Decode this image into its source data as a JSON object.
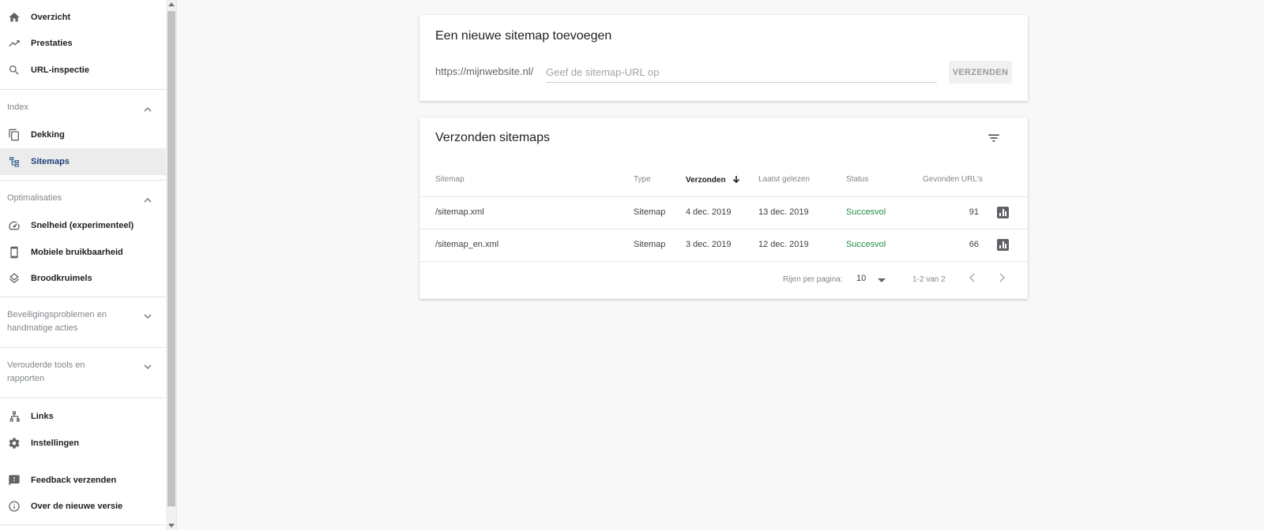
{
  "sidebar": {
    "top_items": [
      {
        "label": "Overzicht",
        "icon": "home-icon"
      },
      {
        "label": "Prestaties",
        "icon": "trending-up-icon"
      },
      {
        "label": "URL-inspectie",
        "icon": "search-icon"
      }
    ],
    "sections": {
      "index": {
        "label": "Index",
        "expanded": true
      },
      "optimalisaties": {
        "label": "Optimalisaties",
        "expanded": true
      },
      "beveiliging": {
        "line1": "Beveiligingsproblemen en",
        "line2": "handmatige acties",
        "expanded": false
      },
      "verouderd": {
        "line1": "Verouderde tools en",
        "line2": "rapporten",
        "expanded": false
      }
    },
    "index_items": [
      {
        "label": "Dekking",
        "icon": "copy-pages-icon"
      },
      {
        "label": "Sitemaps",
        "icon": "sitemap-icon",
        "active": true
      }
    ],
    "optim_items": [
      {
        "label": "Snelheid (experimenteel)",
        "icon": "speedometer-icon"
      },
      {
        "label": "Mobiele bruikbaarheid",
        "icon": "smartphone-icon"
      },
      {
        "label": "Broodkruimels",
        "icon": "layers-icon"
      }
    ],
    "bottom_items": [
      {
        "label": "Links",
        "icon": "network-icon"
      },
      {
        "label": "Instellingen",
        "icon": "gear-icon"
      },
      {
        "label": "Feedback verzenden",
        "icon": "feedback-icon"
      },
      {
        "label": "Over de nieuwe versie",
        "icon": "info-icon"
      }
    ]
  },
  "add_card": {
    "title": "Een nieuwe sitemap toevoegen",
    "prefix": "https://mijnwebsite.nl/",
    "input_value": "",
    "input_placeholder": "Geef de sitemap-URL op",
    "submit_label": "VERZENDEN"
  },
  "list_card": {
    "title": "Verzonden sitemaps",
    "columns": {
      "sitemap": "Sitemap",
      "type": "Type",
      "submitted": "Verzonden",
      "last_read": "Laatst gelezen",
      "status": "Status",
      "found_urls": "Gevonden URL's"
    },
    "rows": [
      {
        "sitemap": "/sitemap.xml",
        "type": "Sitemap",
        "submitted": "4 dec. 2019",
        "last_read": "13 dec. 2019",
        "status": "Succesvol",
        "found_urls": "91"
      },
      {
        "sitemap": "/sitemap_en.xml",
        "type": "Sitemap",
        "submitted": "3 dec. 2019",
        "last_read": "12 dec. 2019",
        "status": "Succesvol",
        "found_urls": "66"
      }
    ],
    "pagination": {
      "rows_per_page_label": "Rijen per pagina:",
      "rows_per_page": "10",
      "range": "1-2 van 2"
    }
  },
  "colors": {
    "success": "#1e8e3e",
    "active_bg": "#ececec",
    "active_text": "#1f3f7a"
  }
}
